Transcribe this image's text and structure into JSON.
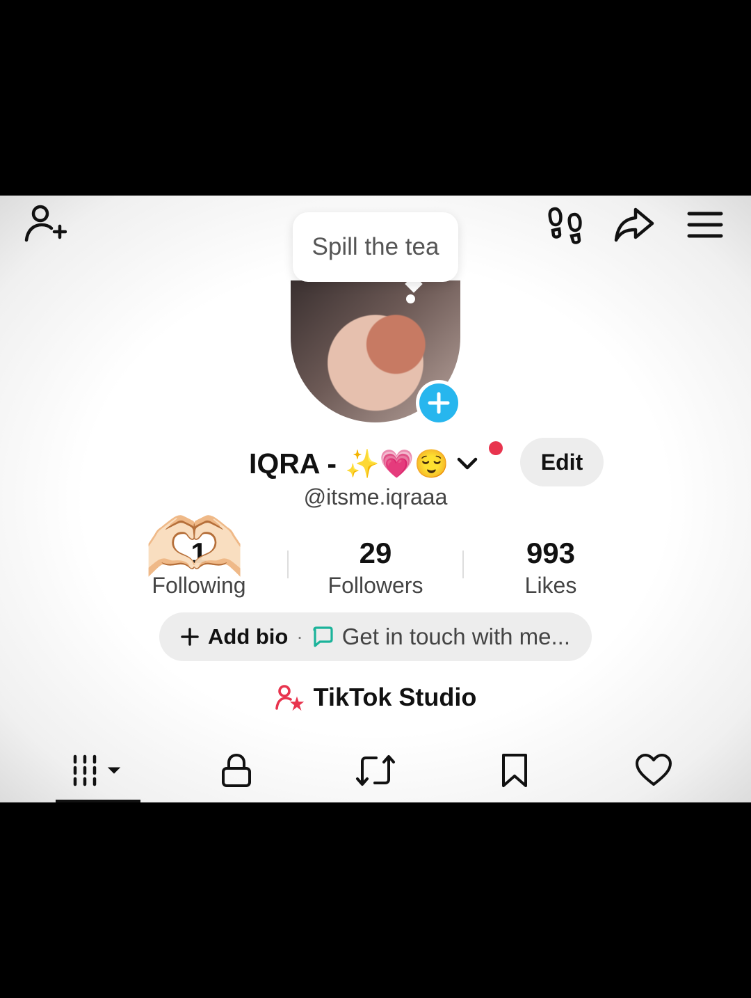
{
  "header": {
    "add_friend_icon": "person-add-icon",
    "footprints_icon": "footprints-icon",
    "share_icon": "share-arrow-icon",
    "menu_icon": "hamburger-menu-icon"
  },
  "tooltip": {
    "text": "Spill the tea"
  },
  "profile": {
    "display_name": "IQRA -",
    "name_emojis": "✨💗😌",
    "handle": "@itsme.iqraaa",
    "edit_label": "Edit",
    "accent_color": "#27b6ee",
    "notification_color": "#e8344e"
  },
  "stats": [
    {
      "value": "1",
      "label": "Following"
    },
    {
      "value": "29",
      "label": "Followers"
    },
    {
      "value": "993",
      "label": "Likes"
    }
  ],
  "stickers": {
    "heart_hands": "🫶🏻"
  },
  "bio": {
    "add_label": "Add bio",
    "separator": "·",
    "contact_text": "Get in touch with me..."
  },
  "studio": {
    "label": "TikTok Studio"
  },
  "tabs": [
    {
      "icon": "grid-videos-icon"
    },
    {
      "icon": "lock-icon"
    },
    {
      "icon": "repost-icon"
    },
    {
      "icon": "bookmark-icon"
    },
    {
      "icon": "heart-icon"
    }
  ]
}
